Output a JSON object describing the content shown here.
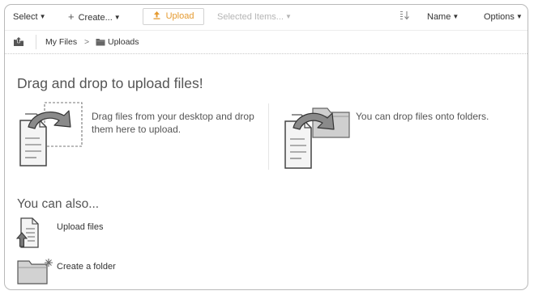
{
  "toolbar": {
    "select_label": "Select",
    "create_label": "Create...",
    "upload_label": "Upload",
    "selected_items_label": "Selected Items...",
    "sort_icon": "sort-icon",
    "name_label": "Name",
    "options_label": "Options",
    "upload_color": "#e59a2f"
  },
  "breadcrumb": {
    "up_icon": "folder-up-icon",
    "root": "My Files",
    "separator": ">",
    "current_icon": "folder-icon",
    "current": "Uploads"
  },
  "main": {
    "heading": "Drag and drop to upload files!",
    "drag_text": "Drag files from your desktop and drop them here to upload.",
    "folder_text": "You can drop files onto folders.",
    "also_heading": "You can also...",
    "actions": [
      {
        "label": "Upload files",
        "icon": "upload-file-icon"
      },
      {
        "label": "Create a folder",
        "icon": "new-folder-icon"
      }
    ]
  }
}
